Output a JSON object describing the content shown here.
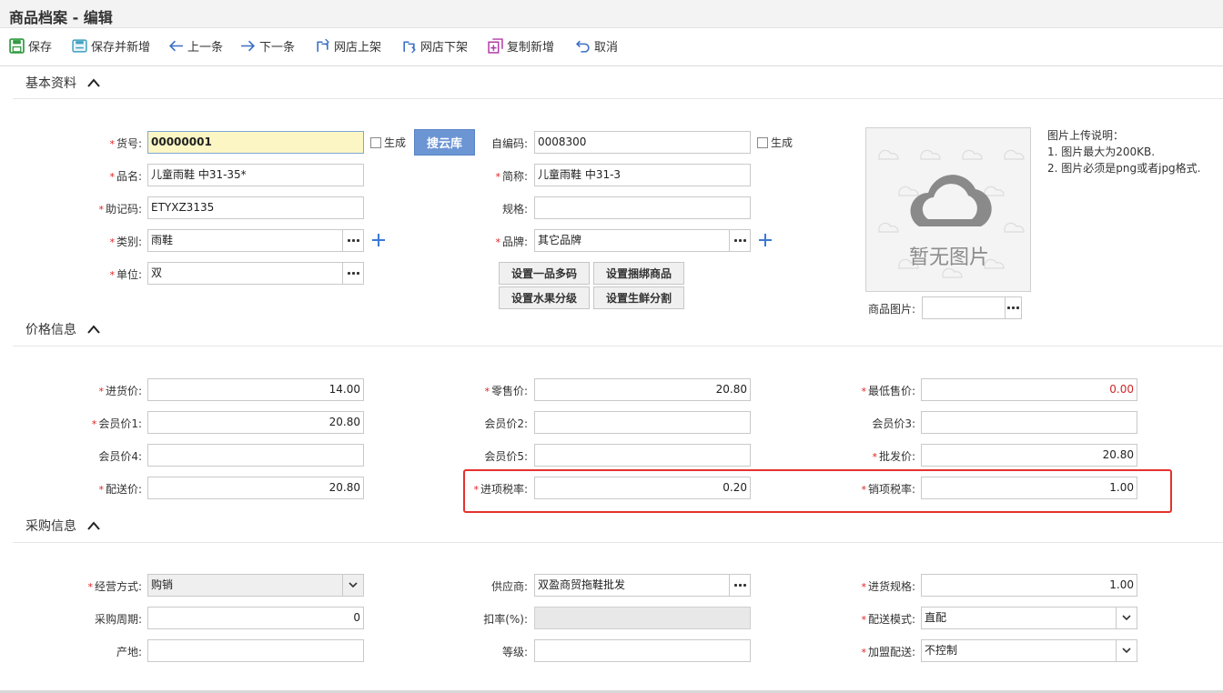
{
  "title": "商品档案 - 编辑",
  "toolbar": {
    "save": "保存",
    "save_new": "保存并新增",
    "prev": "上一条",
    "next": "下一条",
    "shelf_on": "网店上架",
    "shelf_off": "网店下架",
    "copy_new": "复制新增",
    "cancel": "取消"
  },
  "sections": {
    "basic": "基本资料",
    "price": "价格信息",
    "purchase": "采购信息"
  },
  "basic": {
    "item_no_label": "货号:",
    "item_no": "00000001",
    "generate1": "生成",
    "search_cloud": "搜云库",
    "self_code_label": "自编码:",
    "self_code": "0008300",
    "generate2": "生成",
    "name_label": "品名:",
    "name": "儿童雨鞋 中31-35*",
    "short_label": "简称:",
    "short": "儿童雨鞋 中31-3",
    "mnemonic_label": "助记码:",
    "mnemonic": "ETYXZ3135",
    "spec_label": "规格:",
    "spec": "",
    "category_label": "类别:",
    "category": "雨鞋",
    "brand_label": "品牌:",
    "brand": "其它品牌",
    "unit_label": "单位:",
    "unit": "双",
    "btn_multi_code": "设置一品多码",
    "btn_bundle": "设置捆绑商品",
    "btn_fruit": "设置水果分级",
    "btn_fresh": "设置生鲜分割",
    "image_label": "商品图片:",
    "no_image": "暂无图片",
    "upload_title": "图片上传说明：",
    "upload_1": "1. 图片最大为200KB.",
    "upload_2": "2. 图片必须是png或者jpg格式."
  },
  "price": {
    "purchase_label": "进货价:",
    "purchase": "14.00",
    "retail_label": "零售价:",
    "retail": "20.80",
    "min_label": "最低售价:",
    "min": "0.00",
    "member1_label": "会员价1:",
    "member1": "20.80",
    "member2_label": "会员价2:",
    "member2": "",
    "member3_label": "会员价3:",
    "member3": "",
    "member4_label": "会员价4:",
    "member4": "",
    "member5_label": "会员价5:",
    "member5": "",
    "wholesale_label": "批发价:",
    "wholesale": "20.80",
    "delivery_label": "配送价:",
    "delivery": "20.80",
    "input_tax_label": "进项税率:",
    "input_tax": "0.20",
    "output_tax_label": "销项税率:",
    "output_tax": "1.00"
  },
  "purchase": {
    "mode_label": "经营方式:",
    "mode": "购销",
    "supplier_label": "供应商:",
    "supplier": "双盈商贸拖鞋批发",
    "spec_label": "进货规格:",
    "spec": "1.00",
    "cycle_label": "采购周期:",
    "cycle": "0",
    "discount_label": "扣率(%):",
    "discount": "",
    "delivery_mode_label": "配送模式:",
    "delivery_mode": "直配",
    "origin_label": "产地:",
    "origin": "",
    "grade_label": "等级:",
    "grade": "",
    "franchise_label": "加盟配送:",
    "franchise": "不控制"
  },
  "colors": {
    "required": "#e02020",
    "accent_blue": "#6c95d4",
    "highlight_box": "#e5322d"
  }
}
